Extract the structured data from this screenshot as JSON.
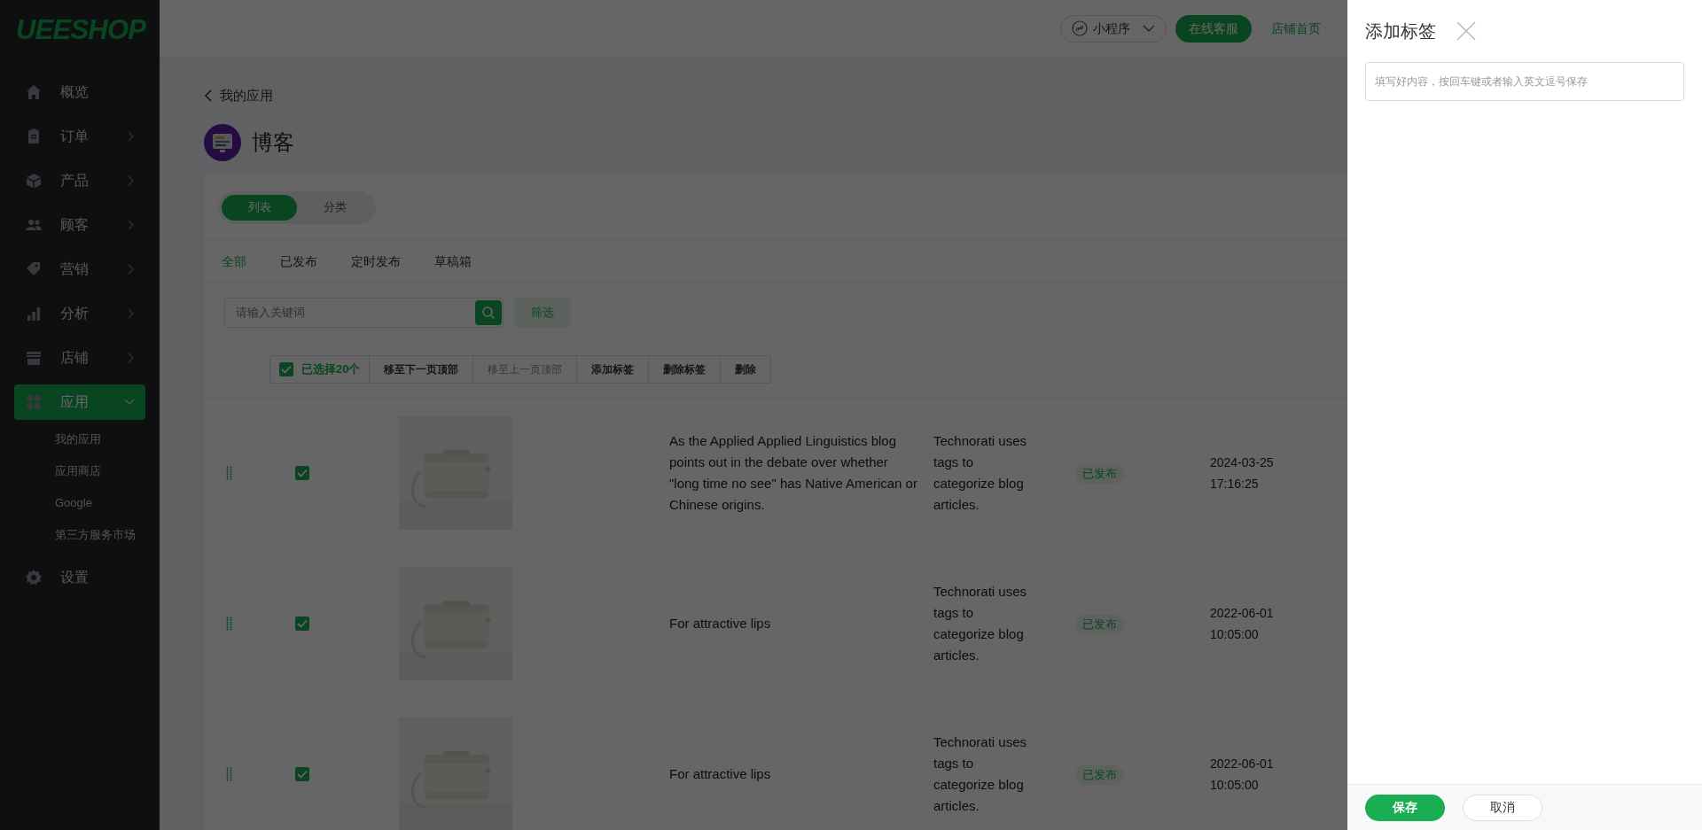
{
  "logo": "UEESHOP",
  "sidebar": {
    "items": [
      {
        "label": "概览",
        "has_arrow": false,
        "selected": false
      },
      {
        "label": "订单",
        "has_arrow": true,
        "selected": false
      },
      {
        "label": "产品",
        "has_arrow": true,
        "selected": false
      },
      {
        "label": "顾客",
        "has_arrow": true,
        "selected": false
      },
      {
        "label": "营销",
        "has_arrow": true,
        "selected": false
      },
      {
        "label": "分析",
        "has_arrow": true,
        "selected": false
      },
      {
        "label": "店铺",
        "has_arrow": true,
        "selected": false
      },
      {
        "label": "应用",
        "has_arrow": true,
        "selected": true,
        "expanded": true,
        "children": [
          {
            "label": "我的应用"
          },
          {
            "label": "应用商店"
          },
          {
            "label": "Google"
          },
          {
            "label": "第三方服务市场"
          }
        ]
      },
      {
        "label": "设置",
        "has_arrow": false,
        "selected": false
      }
    ]
  },
  "topbar": {
    "mini_program": "小程序",
    "service_button": "在线客服",
    "store_link": "店铺首页"
  },
  "breadcrumb": "我的应用",
  "page_title": "博客",
  "view_toggle": [
    {
      "label": "列表",
      "selected": true
    },
    {
      "label": "分类",
      "selected": false
    }
  ],
  "tabs": [
    {
      "label": "全部",
      "selected": true
    },
    {
      "label": "已发布",
      "selected": false
    },
    {
      "label": "定时发布",
      "selected": false
    },
    {
      "label": "草稿箱",
      "selected": false
    }
  ],
  "search": {
    "placeholder": "请输入关键词"
  },
  "filter_button": "筛选",
  "bulk_bar": {
    "checked": true,
    "count": "已选择20个",
    "actions": [
      {
        "label": "移至下一页顶部",
        "disabled": false
      },
      {
        "label": "移至上一页顶部",
        "disabled": true
      },
      {
        "label": "添加标签",
        "disabled": false
      },
      {
        "label": "删除标签",
        "disabled": false
      },
      {
        "label": "删除",
        "disabled": false
      }
    ]
  },
  "rows": [
    {
      "checked": true,
      "title": "As the Applied Applied Linguistics blog points out in the debate over whether \"long time no see\" has Native American or Chinese origins.",
      "tags": "Technorati uses tags to categorize blog articles.",
      "status": "已发布",
      "date": "2024-03-25",
      "time": "17:16:25"
    },
    {
      "checked": true,
      "title": "For attractive lips",
      "tags": "Technorati uses tags to categorize blog articles.",
      "status": "已发布",
      "date": "2022-06-01",
      "time": "10:05:00"
    },
    {
      "checked": true,
      "title": "For attractive lips",
      "tags": "Technorati uses tags to categorize blog articles.",
      "status": "已发布",
      "date": "2022-06-01",
      "time": "10:05:00"
    }
  ],
  "panel": {
    "title": "添加标签",
    "input": {
      "placeholder": "填写好内容，按回车键或者输入英文逗号保存"
    },
    "save_button": "保存",
    "cancel_button": "取消"
  }
}
